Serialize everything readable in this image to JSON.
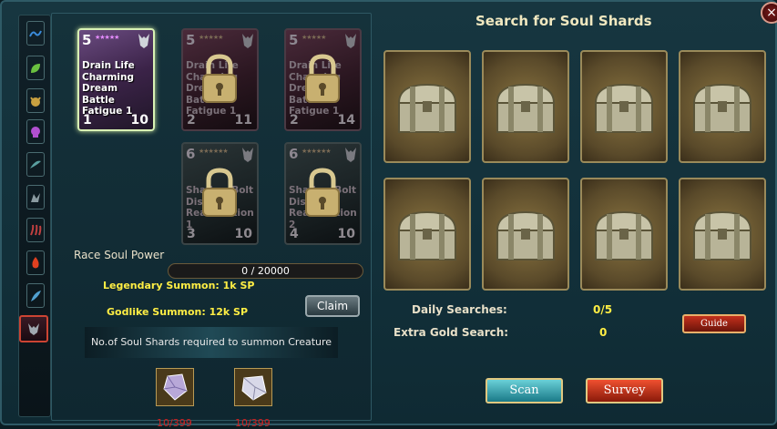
{
  "dialog": {
    "title": "Search for Soul Shards",
    "close_label": "×"
  },
  "side_tabs": [
    {
      "icon": "wave-icon",
      "color": "#3a8ad8"
    },
    {
      "icon": "leaf-icon",
      "color": "#6ac040"
    },
    {
      "icon": "beast-icon",
      "color": "#c8a040"
    },
    {
      "icon": "skull-icon",
      "color": "#b050d0"
    },
    {
      "icon": "wing-icon",
      "color": "#5aa0a0"
    },
    {
      "icon": "dragon-icon",
      "color": "#8a9aa0"
    },
    {
      "icon": "claw-icon",
      "color": "#c04040"
    },
    {
      "icon": "flame-icon",
      "color": "#e04020"
    },
    {
      "icon": "feather-icon",
      "color": "#50a0d0"
    },
    {
      "icon": "demon-icon",
      "color": "#c03040",
      "active": true
    }
  ],
  "creature_cards": [
    {
      "level": "5",
      "stars": "★★★★★",
      "skills": [
        "Drain Life",
        "Charming",
        "Dream Battle",
        "Fatigue 1"
      ],
      "left_num": "1",
      "right_num": "10",
      "locked": false
    },
    {
      "level": "5",
      "stars": "★★★★★",
      "skills": [
        "Drain Life",
        "Charming",
        "Dream Battle",
        "Fatigue 1"
      ],
      "left_num": "2",
      "right_num": "11",
      "locked": true
    },
    {
      "level": "5",
      "stars": "★★★★★",
      "skills": [
        "Drain Life",
        "Charming",
        "Dream Battle",
        "Fatigue 1"
      ],
      "left_num": "2",
      "right_num": "14",
      "locked": true
    },
    {
      "level": "6",
      "stars": "★★★★★★",
      "skills": [
        "Shadow Bolt",
        "Distort 1",
        "Reanimation 1"
      ],
      "left_num": "3",
      "right_num": "10",
      "locked": true
    },
    {
      "level": "6",
      "stars": "★★★★★★",
      "skills": [
        "Shadow Bolt",
        "Distort 2",
        "Reanimation 2"
      ],
      "left_num": "4",
      "right_num": "10",
      "locked": true
    }
  ],
  "race_soul_power": {
    "label": "Race Soul Power",
    "value": "0 / 20000",
    "fraction": 0
  },
  "summons": {
    "legendary": "Legendary Summon: 1k SP",
    "godlike": "Godlike Summon: 12k SP",
    "claim_label": "Claim"
  },
  "shards": {
    "notice": "No.of Soul Shards required to summon Creature",
    "items": [
      {
        "icon": "purple-crystal-icon",
        "count": "10/399"
      },
      {
        "icon": "white-crystal-icon",
        "count": "10/399"
      }
    ]
  },
  "chests": [
    {
      "icon": "chest-icon"
    },
    {
      "icon": "chest-icon"
    },
    {
      "icon": "chest-icon"
    },
    {
      "icon": "chest-icon"
    },
    {
      "icon": "chest-icon"
    },
    {
      "icon": "chest-icon"
    },
    {
      "icon": "chest-icon"
    },
    {
      "icon": "chest-icon"
    }
  ],
  "stats": {
    "daily_label": "Daily Searches:",
    "daily_value": "0/5",
    "gold_label": "Extra Gold Search:",
    "gold_value": "0"
  },
  "buttons": {
    "guide": "Guide",
    "scan": "Scan",
    "survey": "Survey"
  }
}
